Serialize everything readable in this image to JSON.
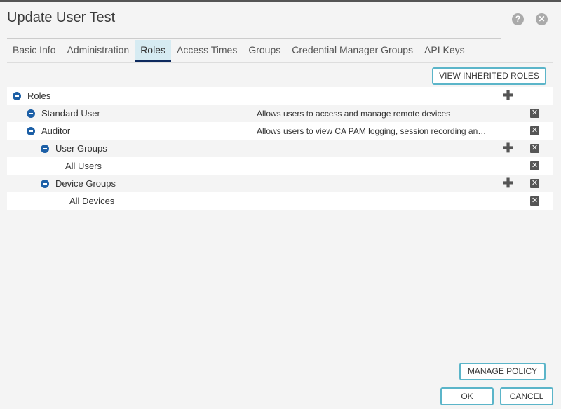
{
  "dialog": {
    "title": "Update User Test"
  },
  "tabs": [
    "Basic Info",
    "Administration",
    "Roles",
    "Access Times",
    "Groups",
    "Credential Manager Groups",
    "API Keys"
  ],
  "buttons": {
    "view_inherited": "VIEW INHERITED ROLES",
    "manage_policy": "MANAGE POLICY",
    "ok": "OK",
    "cancel": "CANCEL"
  },
  "tree": [
    {
      "label": "Roles",
      "desc": ""
    },
    {
      "label": "Standard User",
      "desc": "Allows users to access and manage remote devices"
    },
    {
      "label": "Auditor",
      "desc": "Allows users to view CA PAM logging, session recording an…"
    },
    {
      "label": "User Groups",
      "desc": ""
    },
    {
      "label": "All Users",
      "desc": ""
    },
    {
      "label": "Device Groups",
      "desc": ""
    },
    {
      "label": "All Devices",
      "desc": ""
    }
  ],
  "icons": {
    "help": "?",
    "close": "✕",
    "plus": "✚",
    "remove": "✕"
  }
}
